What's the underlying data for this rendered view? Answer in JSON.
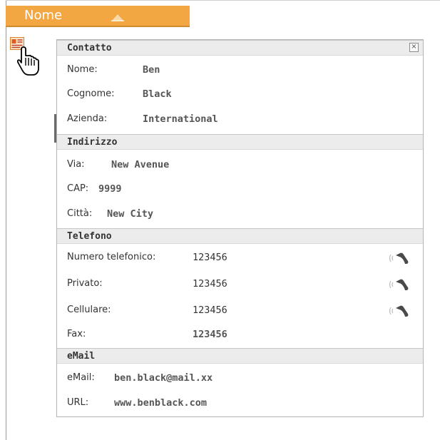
{
  "column_header": {
    "title": "Nome",
    "sort_direction": "ascending"
  },
  "icons": {
    "contact": "contact-card-icon",
    "cursor": "hand-pointer-icon",
    "sort": "triangle-up-icon",
    "phone": "phone-call-icon"
  },
  "colors": {
    "header_bg": "#f2a743",
    "section_bg": "#ececec"
  },
  "contact_card": {
    "sections": {
      "contatto": "Contatto",
      "indirizzo": "Indirizzo",
      "telefono": "Telefono",
      "email": "eMail"
    },
    "close_label": "×",
    "contatto": {
      "nome_label": "Nome:",
      "nome": "Ben",
      "cognome_label": "Cognome:",
      "cognome": "Black",
      "azienda_label": "Azienda:",
      "azienda": "International"
    },
    "indirizzo": {
      "via_label": "Via:",
      "via": "New Avenue",
      "cap_label": "CAP:",
      "cap": "9999",
      "citta_label": "Città:",
      "citta": "New City"
    },
    "telefono": {
      "numero_label": "Numero telefonico:",
      "numero": "123456",
      "privato_label": "Privato:",
      "privato": "123456",
      "cellulare_label": "Cellulare:",
      "cellulare": "123456",
      "fax_label": "Fax:",
      "fax": "123456"
    },
    "email": {
      "email_label": "eMail:",
      "email": "ben.black@mail.xx",
      "url_label": "URL:",
      "url": "www.benblack.com"
    }
  }
}
